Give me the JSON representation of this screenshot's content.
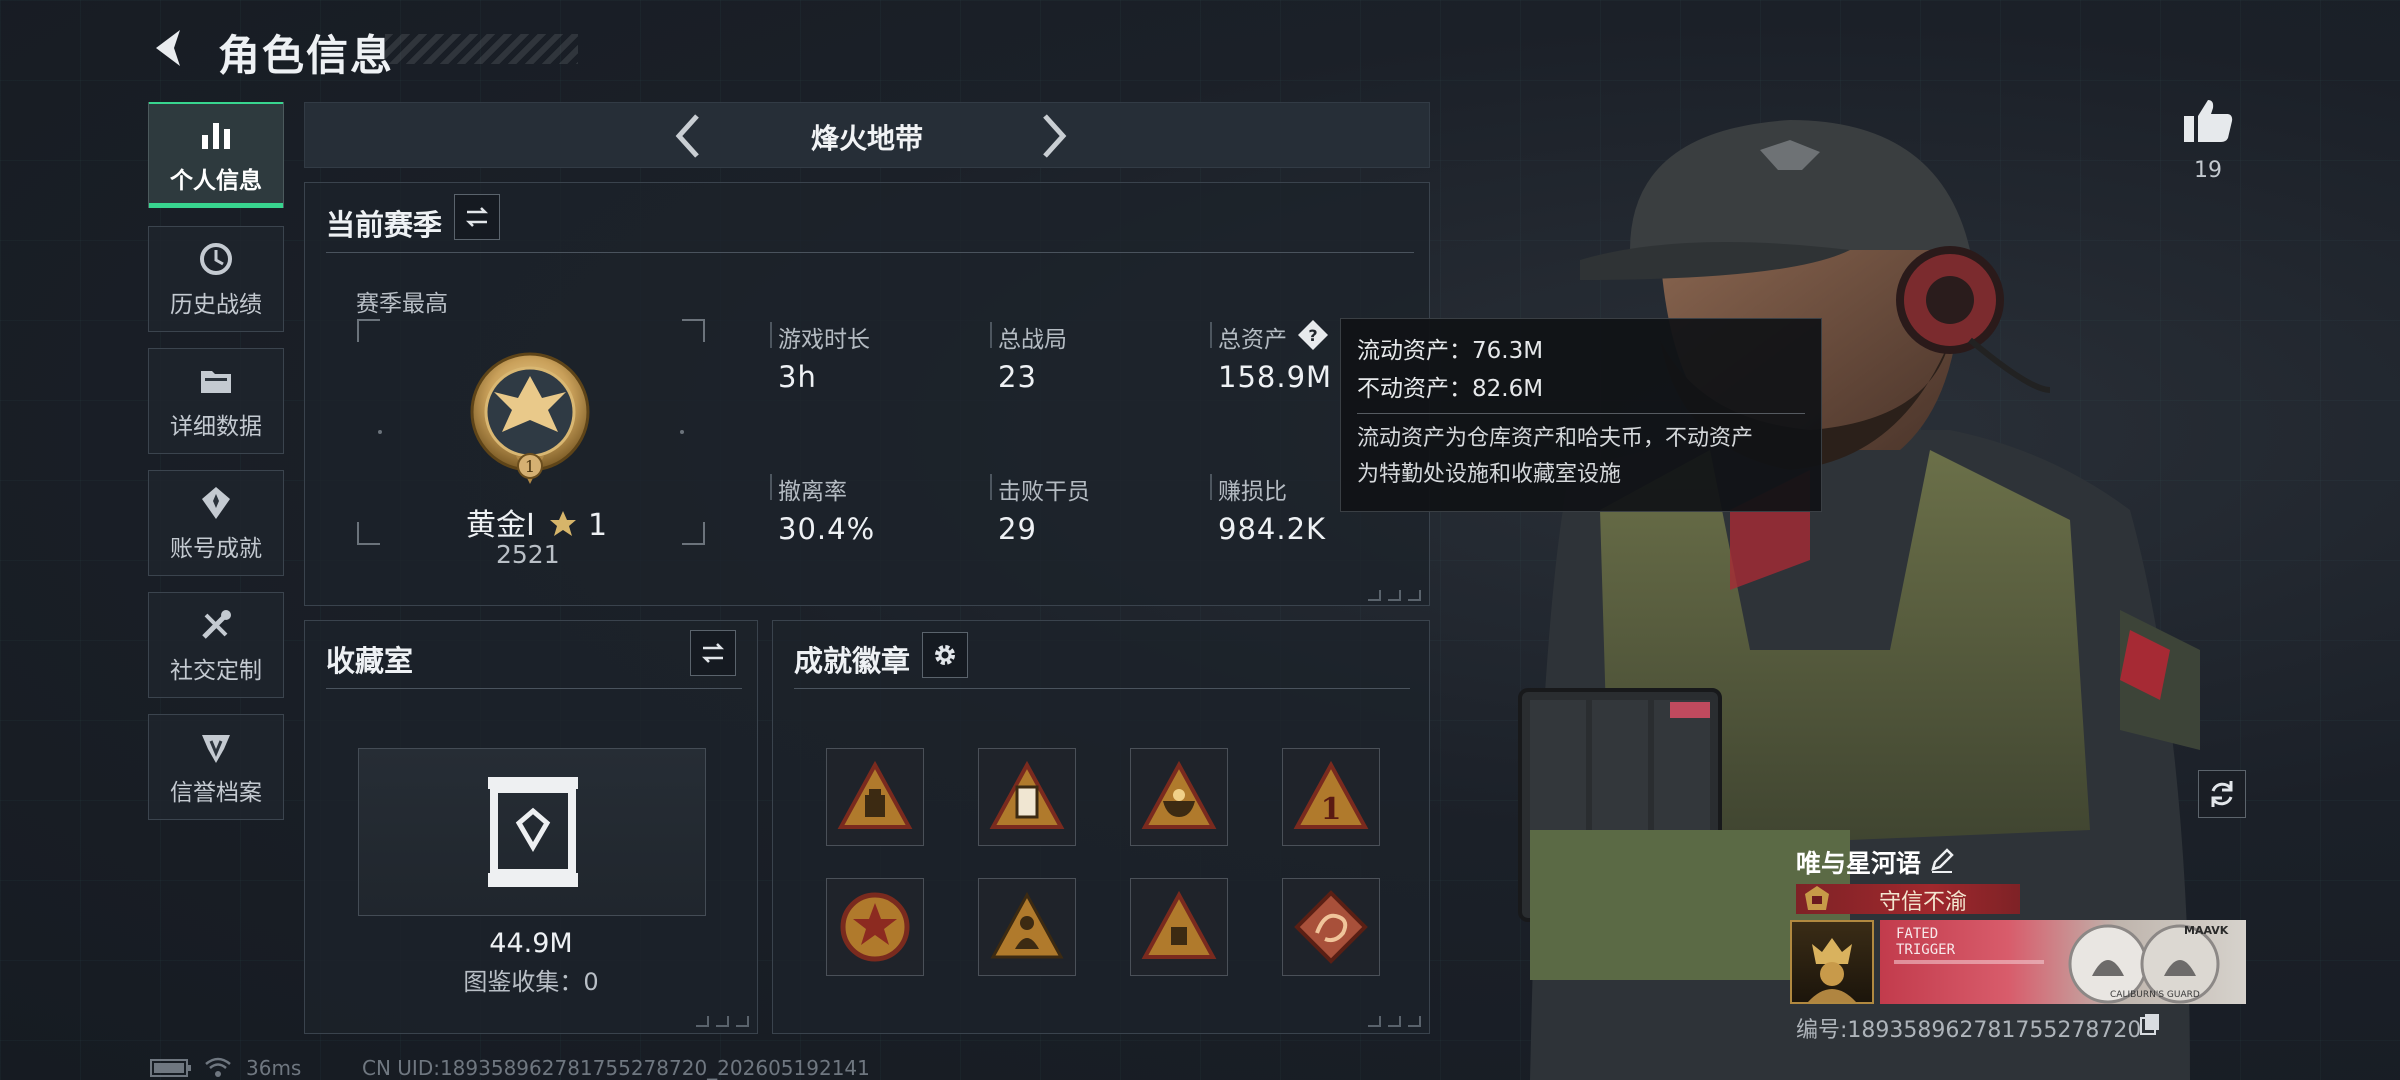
{
  "header": {
    "title": "角色信息"
  },
  "nav": {
    "items": [
      {
        "label": "个人信息",
        "icon": "bar-chart-icon"
      },
      {
        "label": "历史战绩",
        "icon": "history-clock-icon"
      },
      {
        "label": "详细数据",
        "icon": "folder-icon"
      },
      {
        "label": "账号成就",
        "icon": "achievement-icon"
      },
      {
        "label": "社交定制",
        "icon": "tools-icon"
      },
      {
        "label": "信誉档案",
        "icon": "reputation-icon"
      }
    ],
    "active_index": 0
  },
  "mode": {
    "name": "烽火地带"
  },
  "season": {
    "title": "当前赛季",
    "best_label": "赛季最高",
    "rank_name": "黄金Ⅰ",
    "rank_stars": "1",
    "rank_score": "2521",
    "rank_level_numeral": "1",
    "stats": [
      {
        "label": "游戏时长",
        "value": "3h"
      },
      {
        "label": "总战局",
        "value": "23"
      },
      {
        "label": "总资产",
        "value": "158.9M"
      },
      {
        "label": "撤离率",
        "value": "30.4%"
      },
      {
        "label": "击败干员",
        "value": "29"
      },
      {
        "label": "赚损比",
        "value": "984.2K"
      }
    ]
  },
  "tooltip": {
    "liquid": "流动资产：76.3M",
    "fixed": "不动资产：82.6M",
    "desc_line1": "流动资产为仓库资产和哈夫币，不动资产",
    "desc_line2": "为特勤处设施和收藏室设施"
  },
  "collection": {
    "title": "收藏室",
    "value": "44.9M",
    "count_text": "图鉴收集：0"
  },
  "badges": {
    "title": "成就徽章",
    "items": [
      "badge-bag",
      "badge-trophy",
      "badge-bowl",
      "badge-number-one",
      "badge-star-shield",
      "badge-figure",
      "badge-cube",
      "badge-dragon"
    ]
  },
  "profile": {
    "likes": "19",
    "player_name": "唯与星河语",
    "title": "守信不渝",
    "card_text_1": "FATED",
    "card_text_2": "TRIGGER",
    "card_text_3": "MAAVK",
    "card_text_4": "CALIBURN'S GUARD",
    "id_line": "编号:1893589627817552787​20"
  },
  "footer": {
    "ping": "36ms",
    "uid": "CN UID:1893589627817552787​20_202605192141"
  },
  "colors": {
    "accent": "#38d58f",
    "title_red": "#a0282d",
    "gold": "#c9a05a"
  }
}
